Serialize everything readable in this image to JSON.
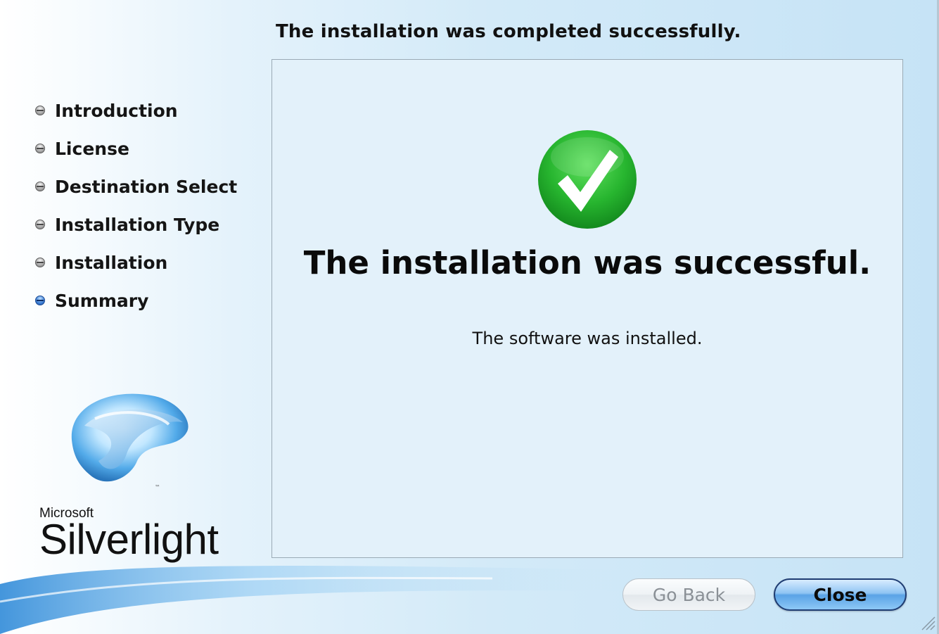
{
  "header": {
    "title": "The installation was completed successfully."
  },
  "sidebar": {
    "steps": [
      {
        "label": "Introduction",
        "active": false
      },
      {
        "label": "License",
        "active": false
      },
      {
        "label": "Destination Select",
        "active": false
      },
      {
        "label": "Installation Type",
        "active": false
      },
      {
        "label": "Installation",
        "active": false
      },
      {
        "label": "Summary",
        "active": true
      }
    ],
    "brand": {
      "company": "Microsoft",
      "product": "Silverlight",
      "logo_icon": "silverlight-logo-icon"
    }
  },
  "content": {
    "icon": "checkmark-success-icon",
    "heading": "The installation was successful.",
    "message": "The software was installed."
  },
  "buttons": {
    "back_label": "Go Back",
    "back_enabled": false,
    "close_label": "Close"
  },
  "colors": {
    "success_green": "#27b52f",
    "accent_blue": "#5aa3e6",
    "panel_bg": "#e3f1fa"
  }
}
